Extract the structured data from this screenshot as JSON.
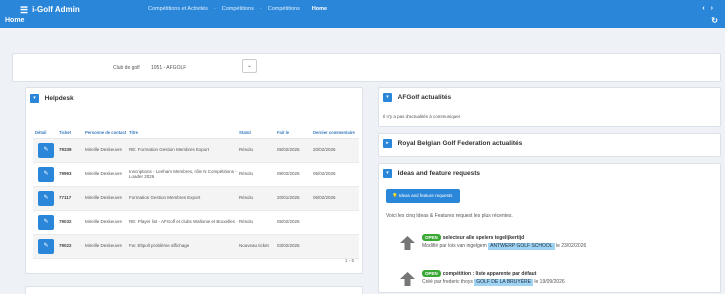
{
  "app": {
    "title": "i-Golf Admin",
    "page_title": "Home"
  },
  "breadcrumb": {
    "items": [
      "Compétitions et Activités",
      "Compétitions",
      "Compétitions"
    ],
    "current": "Home"
  },
  "club": {
    "label": "Club de golf",
    "value": "1051 - AFGOLF"
  },
  "helpdesk": {
    "title": "Helpdesk",
    "columns": [
      "Détail",
      "Ticket",
      "Personne de contact",
      "Titre",
      "Statut",
      "Fait le",
      "Dernier commentaire"
    ],
    "rows": [
      {
        "ticket": "79339",
        "contact": "Mireille Deskeuvre",
        "title": "RE: Formation Gestion Membres Export",
        "status": "Résolu",
        "done": "05/02/2026",
        "last": "20/02/2026"
      },
      {
        "ticket": "79993",
        "contact": "Mireille Deskeuvre",
        "title": "Inscriptions - Lenham Membres, rôle N Compétitions - Loader 2026",
        "status": "Résolu",
        "done": "09/02/2026",
        "last": "05/02/2026"
      },
      {
        "ticket": "77117",
        "contact": "Mireille Deskeuvre",
        "title": "Formation Gestion Membres Export",
        "status": "Résolu",
        "done": "20/01/2026",
        "last": "05/02/2026"
      },
      {
        "ticket": "79032",
        "contact": "Mireille Deskeuvre",
        "title": "RE: Player list - AFGolf et clubs Wallonie et Bruxelles",
        "status": "Résolu",
        "done": "05/02/2026",
        "last": ""
      },
      {
        "ticket": "79022",
        "contact": "Mireille Deskeuvre",
        "title": "Fw: Eltpoll problème affichage",
        "status": "Nouveau ticket",
        "done": "03/02/2026",
        "last": ""
      }
    ],
    "pager": "1 - 5"
  },
  "afgolf": {
    "title": "AFGolf actualités",
    "message": "Il n'y a pas d'actualités à communiquer"
  },
  "rbgf": {
    "title": "Royal Belgian Golf Federation actualités"
  },
  "ideas": {
    "title": "Ideas and feature requests",
    "button": "Ideas and feature requests",
    "intro": "Voici les cinq Ideas & Features request les plus récentes.",
    "items": [
      {
        "badge": "OPEN",
        "title": "selecteur alle spelers tegelijkertijd",
        "prefix": "Modifié par lois van ingelgem",
        "tag": "ANTWERP GOLF SCHOOL",
        "date": "le 23/02/2026"
      },
      {
        "badge": "OPEN",
        "title": "compétition : liste apparente par défaut",
        "prefix": "Créé par frederic thoys",
        "tag": "GOLF DE LA BRUYÈRE",
        "date": "le 19/09/2026"
      }
    ]
  },
  "colors": {
    "accent": "#2a86d8",
    "open": "#3aa835",
    "tag": "#9fd3f4"
  },
  "icons": [
    "menu-icon",
    "pencil-icon",
    "chevron-down-icon",
    "refresh-icon",
    "lightbulb-icon",
    "arrow-up-icon"
  ]
}
